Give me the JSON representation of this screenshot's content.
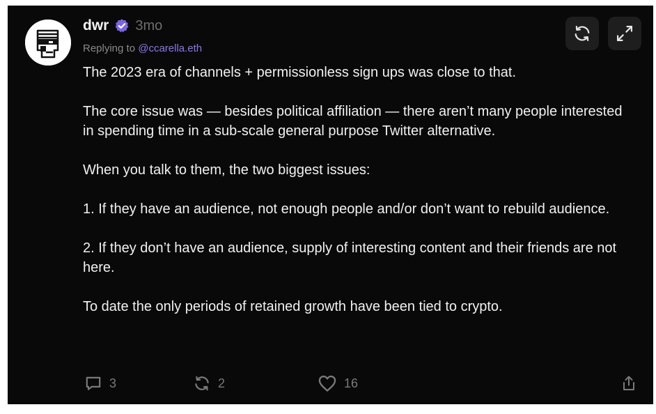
{
  "post": {
    "author": {
      "name": "dwr",
      "verified": true,
      "avatar_icon": "avatar-icon"
    },
    "time_ago": "3mo",
    "replying_to": {
      "prefix": "Replying to",
      "handle": "@ccarella.eth"
    },
    "paragraphs": [
      "The 2023 era of channels + permissionless sign ups was close to that.",
      "The core issue was — besides political affiliation — there aren’t many people interested in spending time in a sub-scale general purpose Twitter alternative.",
      "When you talk to them, the two biggest issues:",
      "1. If they have an audience, not enough people and/or don’t want to rebuild audience.",
      "2. If they don’t have an audience, supply of interesting content and their friends are not here.",
      "To date the only periods of retained growth have been tied to crypto."
    ],
    "actions": {
      "replies": "3",
      "recasts": "2",
      "likes": "16"
    }
  },
  "toolbar": {
    "icons": [
      "refresh-icon",
      "expand-icon"
    ]
  },
  "colors": {
    "background": "#090909",
    "text": "#f1f1f1",
    "muted": "#7a7a7a",
    "mention": "#8b77ea",
    "verified": "#7c65e0",
    "button_bg": "#1e1e1e"
  }
}
